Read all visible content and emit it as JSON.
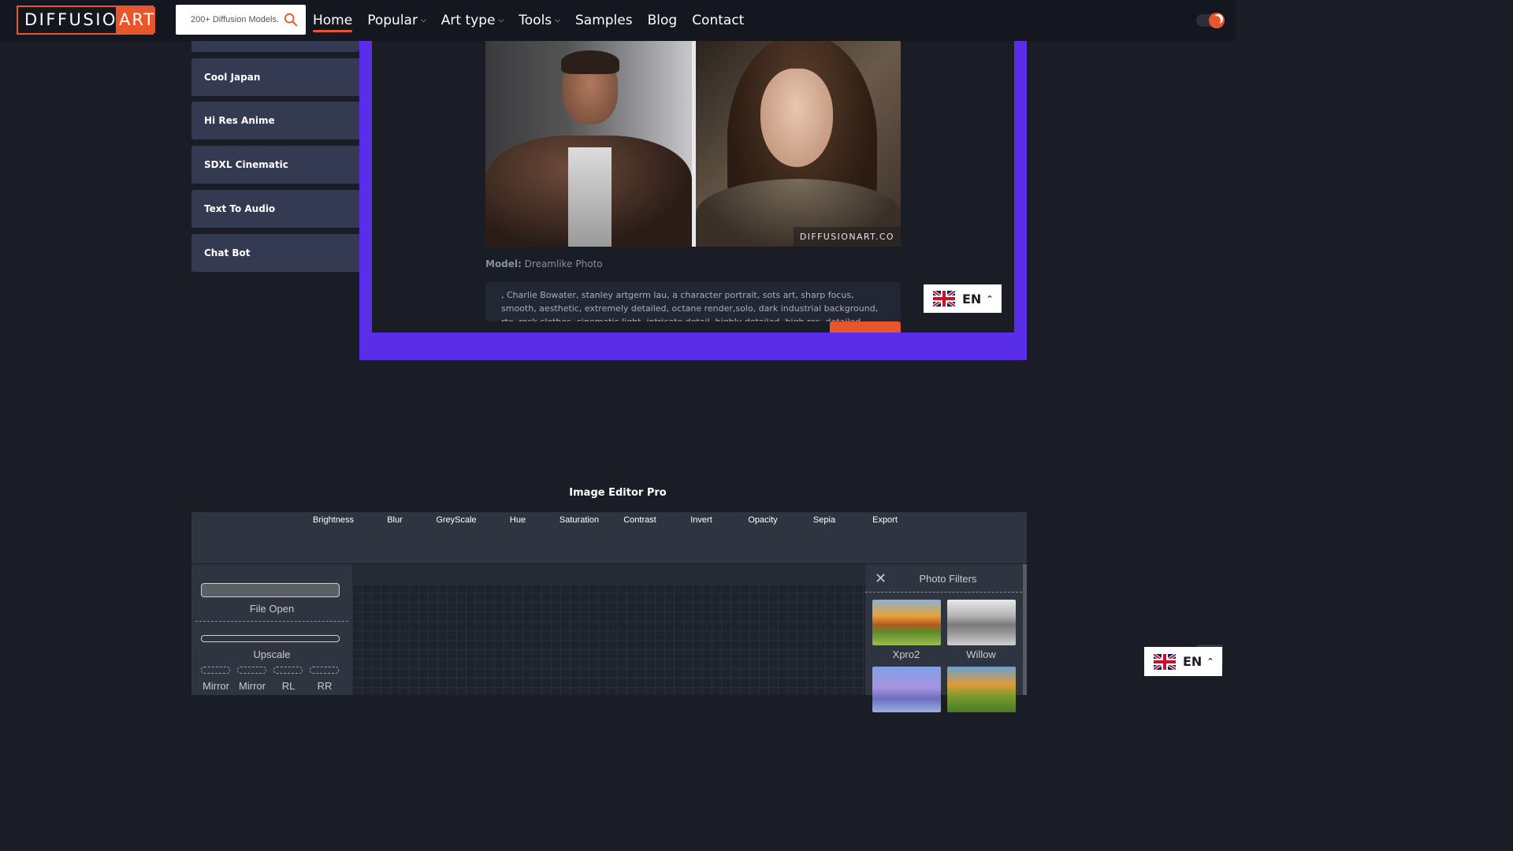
{
  "navbar": {
    "logo_part1": "DIFFUSION",
    "logo_part2": "ART",
    "search_placeholder": "200+ Diffusion Models..",
    "links": [
      {
        "label": "Home",
        "active": true
      },
      {
        "label": "Popular",
        "dropdown": true
      },
      {
        "label": "Art type",
        "dropdown": true
      },
      {
        "label": "Tools",
        "dropdown": true
      },
      {
        "label": "Samples"
      },
      {
        "label": "Blog"
      },
      {
        "label": "Contact"
      }
    ],
    "accent_color": "#e8572b"
  },
  "sidebar": {
    "items": [
      "Cool Japan",
      "Hi Res Anime",
      "SDXL Cinematic",
      "Text To Audio",
      "Chat Bot"
    ]
  },
  "showcase": {
    "watermark": "DIFFUSIONART.CO",
    "model_label": "Model:",
    "model_value": "Dreamlike Photo",
    "prompt": ", Charlie Bowater, stanley artgerm lau, a character portrait, sots art, sharp focus, smooth, aesthetic, extremely detailed, octane render,solo, dark industrial background, rtx, rock clothes, cinematic light, intricate detail, highly detailed, high res, detailed facial features",
    "frame_color": "#5a2ee8"
  },
  "language": {
    "code": "EN",
    "flag": "uk-flag-icon"
  },
  "editor": {
    "title": "Image Editor Pro",
    "tools": [
      "Brightness",
      "Blur",
      "GreyScale",
      "Hue",
      "Saturation",
      "Contrast",
      "Invert",
      "Opacity",
      "Sepia",
      "Export"
    ],
    "left_panel": {
      "file_open": "File Open",
      "upscale": "Upscale",
      "mirror1": "Mirror",
      "mirror2": "Mirror",
      "rl": "RL",
      "rr": "RR"
    },
    "filters": {
      "title": "Photo Filters",
      "items": [
        "Xpro2",
        "Willow"
      ]
    }
  }
}
